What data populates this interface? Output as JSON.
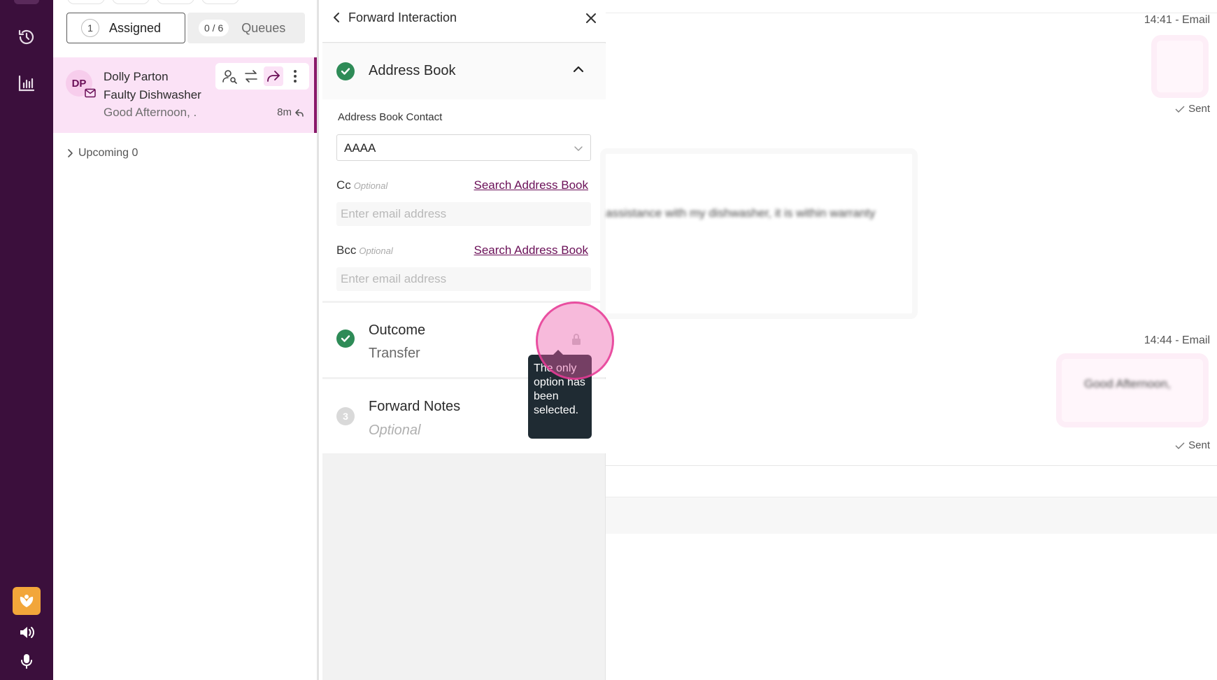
{
  "queue": {
    "assigned_count": "1",
    "assigned_label": "Assigned",
    "queues_count": "0 / 6",
    "queues_label": "Queues",
    "conversation": {
      "initials": "DP",
      "name": "Dolly Parton",
      "subject": "Faulty Dishwasher",
      "preview": "Good Afternoon, .",
      "age": "8m"
    },
    "upcoming_label": "Upcoming 0"
  },
  "forward": {
    "title": "Forward Interaction",
    "address_book": {
      "title": "Address Book",
      "contact_label": "Address Book Contact",
      "contact_value": "AAAA",
      "cc_label": "Cc",
      "bcc_label": "Bcc",
      "optional": "Optional",
      "search_link": "Search Address Book",
      "email_placeholder": "Enter email address"
    },
    "outcome": {
      "title": "Outcome",
      "value": "Transfer"
    },
    "notes": {
      "step": "3",
      "title": "Forward Notes",
      "value": "Optional"
    },
    "tooltip": "The only option has been selected."
  },
  "conversation": {
    "msg1_time": "14:41 - Email",
    "msg1_status": "Sent",
    "incoming_text": "assistance with my dishwasher, it is within warranty",
    "msg2_time": "14:44 - Email",
    "msg2_text": "Good Afternoon,",
    "msg2_status": "Sent"
  },
  "colors": {
    "rail": "#3b0f3c",
    "accent": "#6a0f57",
    "selected_card": "#fbe2f6",
    "success": "#2e8b57",
    "tooltip": "#1f2b33",
    "app_badge": "#f2a63a"
  }
}
